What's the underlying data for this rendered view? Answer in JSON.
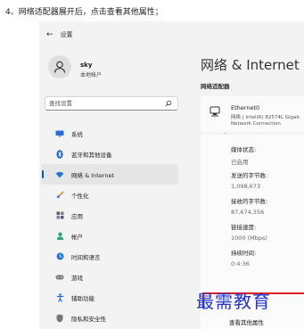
{
  "caption": "4、网络适配器展开后，点击查看其他属性；",
  "window": {
    "back_glyph": "←",
    "title": "设置"
  },
  "user": {
    "name": "sky",
    "account_type": "本地帐户"
  },
  "search": {
    "placeholder": "查找设置"
  },
  "sidebar": {
    "items": [
      {
        "label": "系统",
        "icon": "monitor-icon",
        "color": "#2b6fd6"
      },
      {
        "label": "蓝牙和其他设备",
        "icon": "bluetooth-icon",
        "color": "#1a5fc7"
      },
      {
        "label": "网络 & Internet",
        "icon": "wifi-icon",
        "color": "#2474d8",
        "active": true
      },
      {
        "label": "个性化",
        "icon": "brush-icon",
        "color": "#d98a3a"
      },
      {
        "label": "应用",
        "icon": "apps-icon",
        "color": "#555d6b"
      },
      {
        "label": "帐户",
        "icon": "person-icon",
        "color": "#2fa37a"
      },
      {
        "label": "时间和语言",
        "icon": "globe-clock-icon",
        "color": "#2a78d0"
      },
      {
        "label": "游戏",
        "icon": "game-icon",
        "color": "#777777"
      },
      {
        "label": "辅助功能",
        "icon": "accessibility-icon",
        "color": "#1f63c9"
      },
      {
        "label": "隐私和安全性",
        "icon": "shield-icon",
        "color": "#777777"
      }
    ]
  },
  "main": {
    "title": "网络 & Internet",
    "section": "网络适配器",
    "adapter": {
      "name": "Ethernet0",
      "line1": "网络 | Intel(R) 82574L Gigab",
      "line2": "Network Connection"
    },
    "details": [
      {
        "label": "媒体状态:",
        "value": "已启用"
      },
      {
        "label": "发送的字节数:",
        "value": "1,098,673"
      },
      {
        "label": "接收的字节数:",
        "value": "87,674,356"
      },
      {
        "label": "链接速度:",
        "value": "1000 (Mbps)"
      },
      {
        "label": "持续时间:",
        "value": "0:4:36"
      }
    ],
    "more_properties": "查看其他属性"
  },
  "watermark": "最需教育"
}
